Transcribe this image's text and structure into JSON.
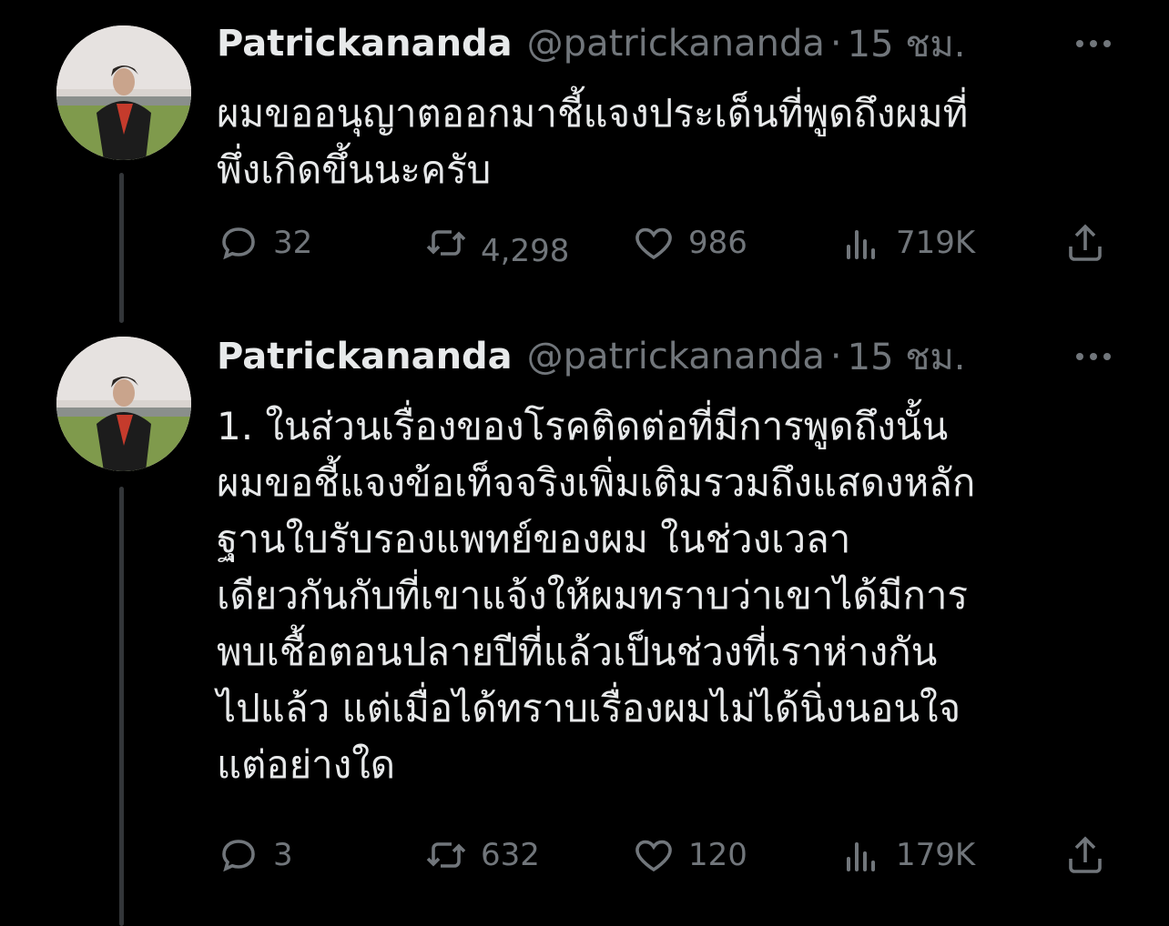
{
  "tweets": [
    {
      "name": "Patrickananda",
      "handle": "@patrickananda",
      "separator": "·",
      "time": "15 ชม.",
      "text_lines": [
        "ผมขออนุญาตออกมาชี้แจงประเด็นที่พูดถึงผมที่",
        "พึ่งเกิดขึ้นนะครับ"
      ],
      "stats": {
        "replies": "32",
        "retweets": "4,298",
        "likes": "986",
        "views": "719K"
      }
    },
    {
      "name": "Patrickananda",
      "handle": "@patrickananda",
      "separator": "·",
      "time": "15 ชม.",
      "text_lines": [
        "1. ในส่วนเรื่องของโรคติดต่อที่มีการพูดถึงนั้น",
        "ผมขอชี้แจงข้อเท็จจริงเพิ่มเติมรวมถึงแสดงหลัก",
        "ฐานใบรับรองแพทย์ของผม ในช่วงเวลา",
        "เดียวกันกับที่เขาแจ้งให้ผมทราบว่าเขาได้มีการ",
        "พบเชื้อตอนปลายปีที่แล้วเป็นช่วงที่เราห่างกัน",
        "ไปแล้ว แต่เมื่อได้ทราบเรื่องผมไม่ได้นิ่งนอนใจ",
        "แต่อย่างใด"
      ],
      "stats": {
        "replies": "3",
        "retweets": "632",
        "likes": "120",
        "views": "179K"
      }
    }
  ],
  "icons": {
    "reply": "reply-icon",
    "retweet": "retweet-icon",
    "like": "heart-icon",
    "views": "views-icon",
    "share": "share-icon",
    "more": "more-icon"
  },
  "colors": {
    "background": "#000000",
    "text": "#e7e9ea",
    "muted": "#71767b",
    "thread_line": "#333639"
  }
}
